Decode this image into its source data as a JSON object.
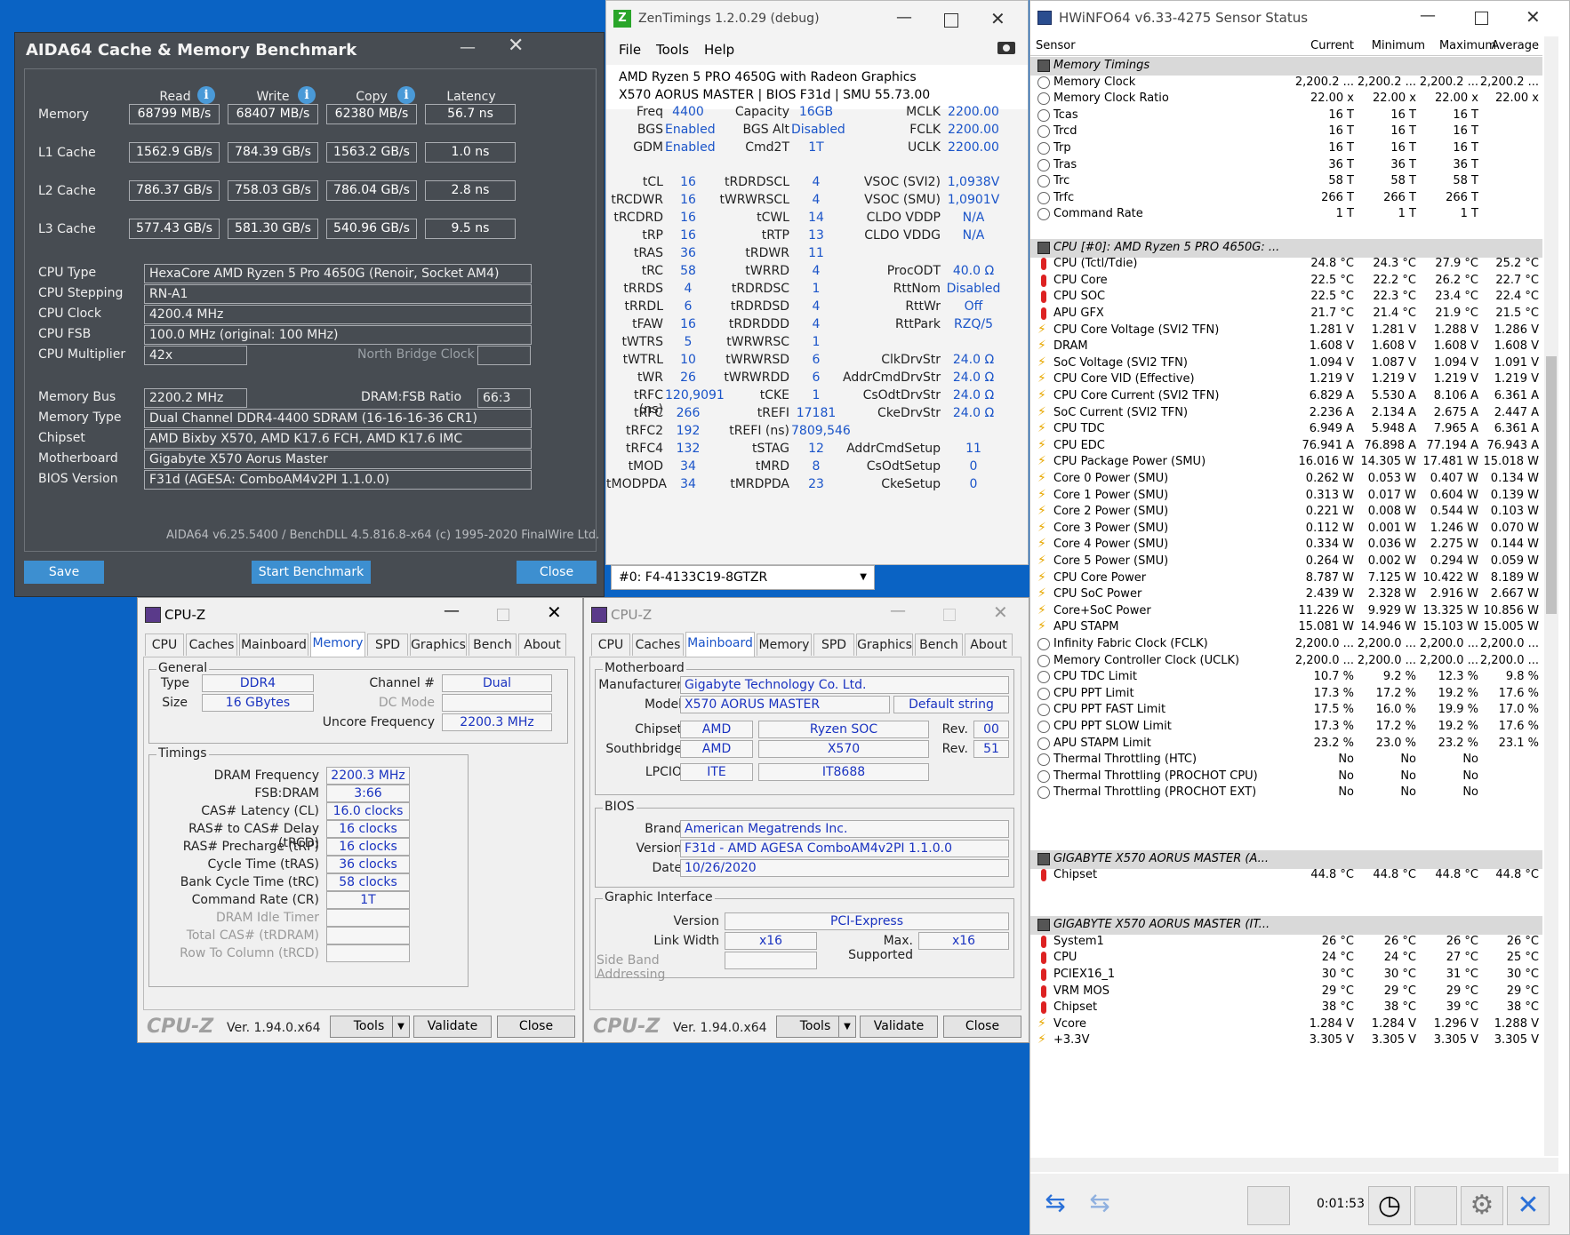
{
  "aida": {
    "title": "AIDA64 Cache & Memory Benchmark",
    "headers": {
      "read": "Read",
      "write": "Write",
      "copy": "Copy",
      "latency": "Latency"
    },
    "rows": [
      {
        "label": "Memory",
        "read": "68799 MB/s",
        "write": "68407 MB/s",
        "copy": "62380 MB/s",
        "latency": "56.7 ns"
      },
      {
        "label": "L1 Cache",
        "read": "1562.9 GB/s",
        "write": "784.39 GB/s",
        "copy": "1563.2 GB/s",
        "latency": "1.0 ns"
      },
      {
        "label": "L2 Cache",
        "read": "786.37 GB/s",
        "write": "758.03 GB/s",
        "copy": "786.04 GB/s",
        "latency": "2.8 ns"
      },
      {
        "label": "L3 Cache",
        "read": "577.43 GB/s",
        "write": "581.30 GB/s",
        "copy": "540.96 GB/s",
        "latency": "9.5 ns"
      }
    ],
    "cpu_type_label": "CPU Type",
    "cpu_type": "HexaCore AMD Ryzen 5 Pro 4650G  (Renoir, Socket AM4)",
    "cpu_stepping_label": "CPU Stepping",
    "cpu_stepping": "RN-A1",
    "cpu_clock_label": "CPU Clock",
    "cpu_clock": "4200.4 MHz",
    "cpu_fsb_label": "CPU FSB",
    "cpu_fsb": "100.0 MHz  (original: 100 MHz)",
    "cpu_mult_label": "CPU Multiplier",
    "cpu_mult": "42x",
    "nb_clock_label": "North Bridge Clock",
    "mem_bus_label": "Memory Bus",
    "mem_bus": "2200.2 MHz",
    "dram_fsb_label": "DRAM:FSB Ratio",
    "dram_fsb": "66:3",
    "mem_type_label": "Memory Type",
    "mem_type": "Dual Channel DDR4-4400 SDRAM  (16-16-16-36 CR1)",
    "chipset_label": "Chipset",
    "chipset": "AMD Bixby X570, AMD K17.6 FCH, AMD K17.6 IMC",
    "mobo_label": "Motherboard",
    "mobo": "Gigabyte X570 Aorus Master",
    "bios_label": "BIOS Version",
    "bios": "F31d  (AGESA: ComboAM4v2PI 1.1.0.0)",
    "footer": "AIDA64 v6.25.5400 / BenchDLL 4.5.816.8-x64  (c) 1995-2020 FinalWire Ltd.",
    "save": "Save",
    "start": "Start Benchmark",
    "close": "Close"
  },
  "zen": {
    "title": "ZenTimings 1.2.0.29 (debug)",
    "menu": [
      "File",
      "Tools",
      "Help"
    ],
    "cpu": "AMD Ryzen 5 PRO 4650G with Radeon Graphics",
    "board": "X570 AORUS MASTER | BIOS F31d | SMU 55.73.00",
    "top": [
      [
        "Freq",
        "4400",
        "Capacity",
        "16GB",
        "MCLK",
        "2200.00"
      ],
      [
        "BGS",
        "Enabled",
        "BGS Alt",
        "Disabled",
        "FCLK",
        "2200.00"
      ],
      [
        "GDM",
        "Enabled",
        "Cmd2T",
        "1T",
        "UCLK",
        "2200.00"
      ]
    ],
    "rows": [
      [
        "tCL",
        "16",
        "tRDRDSCL",
        "4",
        "VSOC (SVI2)",
        "1,0938V"
      ],
      [
        "tRCDWR",
        "16",
        "tWRWRSCL",
        "4",
        "VSOC (SMU)",
        "1,0901V"
      ],
      [
        "tRCDRD",
        "16",
        "tCWL",
        "14",
        "CLDO VDDP",
        "N/A"
      ],
      [
        "tRP",
        "16",
        "tRTP",
        "13",
        "CLDO VDDG",
        "N/A"
      ],
      [
        "tRAS",
        "36",
        "tRDWR",
        "11",
        "",
        ""
      ],
      [
        "tRC",
        "58",
        "tWRRD",
        "4",
        "ProcODT",
        "40.0 Ω"
      ],
      [
        "tRRDS",
        "4",
        "tRDRDSC",
        "1",
        "RttNom",
        "Disabled"
      ],
      [
        "tRRDL",
        "6",
        "tRDRDSD",
        "4",
        "RttWr",
        "Off"
      ],
      [
        "tFAW",
        "16",
        "tRDRDDD",
        "4",
        "RttPark",
        "RZQ/5"
      ],
      [
        "tWTRS",
        "5",
        "tWRWRSC",
        "1",
        "",
        ""
      ],
      [
        "tWTRL",
        "10",
        "tWRWRSD",
        "6",
        "ClkDrvStr",
        "24.0 Ω"
      ],
      [
        "tWR",
        "26",
        "tWRWRDD",
        "6",
        "AddrCmdDrvStr",
        "24.0 Ω"
      ],
      [
        "tRFC (ns)",
        "120,9091",
        "tCKE",
        "1",
        "CsOdtDrvStr",
        "24.0 Ω"
      ],
      [
        "tRFC",
        "266",
        "tREFI",
        "17181",
        "CkeDrvStr",
        "24.0 Ω"
      ],
      [
        "tRFC2",
        "192",
        "tREFI (ns)",
        "7809,546",
        "",
        ""
      ],
      [
        "tRFC4",
        "132",
        "tSTAG",
        "12",
        "AddrCmdSetup",
        "11"
      ],
      [
        "tMOD",
        "34",
        "tMRD",
        "8",
        "CsOdtSetup",
        "0"
      ],
      [
        "tMODPDA",
        "34",
        "tMRDPDA",
        "23",
        "CkeSetup",
        "0"
      ]
    ],
    "dimm": "#0: F4-4133C19-8GTZR"
  },
  "hw": {
    "title": "HWiNFO64 v6.33-4275 Sensor Status",
    "cols": [
      "Sensor",
      "Current",
      "Minimum",
      "Maximum",
      "Average"
    ],
    "rows": [
      {
        "t": "sec",
        "n": "Memory Timings"
      },
      {
        "t": "clk",
        "n": "Memory Clock",
        "v": [
          "2,200.2 ...",
          "2,200.2 ...",
          "2,200.2 ...",
          "2,200.2 ..."
        ]
      },
      {
        "t": "clk",
        "n": "Memory Clock Ratio",
        "v": [
          "22.00 x",
          "22.00 x",
          "22.00 x",
          "22.00 x"
        ]
      },
      {
        "t": "clk",
        "n": "Tcas",
        "v": [
          "16 T",
          "16 T",
          "16 T",
          ""
        ]
      },
      {
        "t": "clk",
        "n": "Trcd",
        "v": [
          "16 T",
          "16 T",
          "16 T",
          ""
        ]
      },
      {
        "t": "clk",
        "n": "Trp",
        "v": [
          "16 T",
          "16 T",
          "16 T",
          ""
        ]
      },
      {
        "t": "clk",
        "n": "Tras",
        "v": [
          "36 T",
          "36 T",
          "36 T",
          ""
        ]
      },
      {
        "t": "clk",
        "n": "Trc",
        "v": [
          "58 T",
          "58 T",
          "58 T",
          ""
        ]
      },
      {
        "t": "clk",
        "n": "Trfc",
        "v": [
          "266 T",
          "266 T",
          "266 T",
          ""
        ]
      },
      {
        "t": "clk",
        "n": "Command Rate",
        "v": [
          "1 T",
          "1 T",
          "1 T",
          ""
        ]
      },
      {
        "t": "gap"
      },
      {
        "t": "sec",
        "n": "CPU [#0]: AMD Ryzen 5 PRO 4650G: ..."
      },
      {
        "t": "temp",
        "n": "CPU (Tctl/Tdie)",
        "v": [
          "24.8 °C",
          "24.3 °C",
          "27.9 °C",
          "25.2 °C"
        ]
      },
      {
        "t": "temp",
        "n": "CPU Core",
        "v": [
          "22.5 °C",
          "22.2 °C",
          "26.2 °C",
          "22.7 °C"
        ]
      },
      {
        "t": "temp",
        "n": "CPU SOC",
        "v": [
          "22.5 °C",
          "22.3 °C",
          "23.4 °C",
          "22.4 °C"
        ]
      },
      {
        "t": "temp",
        "n": "APU GFX",
        "v": [
          "21.7 °C",
          "21.4 °C",
          "21.9 °C",
          "21.5 °C"
        ]
      },
      {
        "t": "volt",
        "n": "CPU Core Voltage (SVI2 TFN)",
        "v": [
          "1.281 V",
          "1.281 V",
          "1.288 V",
          "1.286 V"
        ]
      },
      {
        "t": "volt",
        "n": "DRAM",
        "v": [
          "1.608 V",
          "1.608 V",
          "1.608 V",
          "1.608 V"
        ]
      },
      {
        "t": "volt",
        "n": "SoC Voltage (SVI2 TFN)",
        "v": [
          "1.094 V",
          "1.087 V",
          "1.094 V",
          "1.091 V"
        ]
      },
      {
        "t": "volt",
        "n": "CPU Core VID (Effective)",
        "v": [
          "1.219 V",
          "1.219 V",
          "1.219 V",
          "1.219 V"
        ]
      },
      {
        "t": "volt",
        "n": "CPU Core Current (SVI2 TFN)",
        "v": [
          "6.829 A",
          "5.530 A",
          "8.106 A",
          "6.361 A"
        ]
      },
      {
        "t": "volt",
        "n": "SoC Current (SVI2 TFN)",
        "v": [
          "2.236 A",
          "2.134 A",
          "2.675 A",
          "2.447 A"
        ]
      },
      {
        "t": "volt",
        "n": "CPU TDC",
        "v": [
          "6.949 A",
          "5.948 A",
          "7.965 A",
          "6.361 A"
        ]
      },
      {
        "t": "volt",
        "n": "CPU EDC",
        "v": [
          "76.941 A",
          "76.898 A",
          "77.194 A",
          "76.943 A"
        ]
      },
      {
        "t": "volt",
        "n": "CPU Package Power (SMU)",
        "v": [
          "16.016 W",
          "14.305 W",
          "17.481 W",
          "15.018 W"
        ]
      },
      {
        "t": "volt",
        "n": "Core 0 Power (SMU)",
        "v": [
          "0.262 W",
          "0.053 W",
          "0.407 W",
          "0.134 W"
        ]
      },
      {
        "t": "volt",
        "n": "Core 1 Power (SMU)",
        "v": [
          "0.313 W",
          "0.017 W",
          "0.604 W",
          "0.139 W"
        ]
      },
      {
        "t": "volt",
        "n": "Core 2 Power (SMU)",
        "v": [
          "0.221 W",
          "0.008 W",
          "0.544 W",
          "0.103 W"
        ]
      },
      {
        "t": "volt",
        "n": "Core 3 Power (SMU)",
        "v": [
          "0.112 W",
          "0.001 W",
          "1.246 W",
          "0.070 W"
        ]
      },
      {
        "t": "volt",
        "n": "Core 4 Power (SMU)",
        "v": [
          "0.334 W",
          "0.036 W",
          "2.275 W",
          "0.144 W"
        ]
      },
      {
        "t": "volt",
        "n": "Core 5 Power (SMU)",
        "v": [
          "0.264 W",
          "0.002 W",
          "0.294 W",
          "0.059 W"
        ]
      },
      {
        "t": "volt",
        "n": "CPU Core Power",
        "v": [
          "8.787 W",
          "7.125 W",
          "10.422 W",
          "8.189 W"
        ]
      },
      {
        "t": "volt",
        "n": "CPU SoC Power",
        "v": [
          "2.439 W",
          "2.328 W",
          "2.916 W",
          "2.667 W"
        ]
      },
      {
        "t": "volt",
        "n": "Core+SoC Power",
        "v": [
          "11.226 W",
          "9.929 W",
          "13.325 W",
          "10.856 W"
        ]
      },
      {
        "t": "volt",
        "n": "APU STAPM",
        "v": [
          "15.081 W",
          "14.946 W",
          "15.103 W",
          "15.005 W"
        ]
      },
      {
        "t": "clk",
        "n": "Infinity Fabric Clock (FCLK)",
        "v": [
          "2,200.0 ...",
          "2,200.0 ...",
          "2,200.0 ...",
          "2,200.0 ..."
        ]
      },
      {
        "t": "clk",
        "n": "Memory Controller Clock (UCLK)",
        "v": [
          "2,200.0 ...",
          "2,200.0 ...",
          "2,200.0 ...",
          "2,200.0 ..."
        ]
      },
      {
        "t": "clk",
        "n": "CPU TDC Limit",
        "v": [
          "10.7 %",
          "9.2 %",
          "12.3 %",
          "9.8 %"
        ]
      },
      {
        "t": "clk",
        "n": "CPU PPT Limit",
        "v": [
          "17.3 %",
          "17.2 %",
          "19.2 %",
          "17.6 %"
        ]
      },
      {
        "t": "clk",
        "n": "CPU PPT FAST Limit",
        "v": [
          "17.5 %",
          "16.0 %",
          "19.9 %",
          "17.0 %"
        ]
      },
      {
        "t": "clk",
        "n": "CPU PPT SLOW Limit",
        "v": [
          "17.3 %",
          "17.2 %",
          "19.2 %",
          "17.6 %"
        ]
      },
      {
        "t": "clk",
        "n": "APU STAPM Limit",
        "v": [
          "23.2 %",
          "23.0 %",
          "23.2 %",
          "23.1 %"
        ]
      },
      {
        "t": "clk",
        "n": "Thermal Throttling (HTC)",
        "v": [
          "No",
          "No",
          "No",
          ""
        ]
      },
      {
        "t": "clk",
        "n": "Thermal Throttling (PROCHOT CPU)",
        "v": [
          "No",
          "No",
          "No",
          ""
        ]
      },
      {
        "t": "clk",
        "n": "Thermal Throttling (PROCHOT EXT)",
        "v": [
          "No",
          "No",
          "No",
          ""
        ]
      },
      {
        "t": "gap"
      },
      {
        "t": "gap"
      },
      {
        "t": "gap"
      },
      {
        "t": "sec",
        "n": "GIGABYTE X570 AORUS MASTER (A..."
      },
      {
        "t": "temp",
        "n": "Chipset",
        "v": [
          "44.8 °C",
          "44.8 °C",
          "44.8 °C",
          "44.8 °C"
        ]
      },
      {
        "t": "gap"
      },
      {
        "t": "gap"
      },
      {
        "t": "sec",
        "n": "GIGABYTE X570 AORUS MASTER (IT..."
      },
      {
        "t": "temp",
        "n": "System1",
        "v": [
          "26 °C",
          "26 °C",
          "26 °C",
          "26 °C"
        ]
      },
      {
        "t": "temp",
        "n": "CPU",
        "v": [
          "24 °C",
          "24 °C",
          "27 °C",
          "25 °C"
        ]
      },
      {
        "t": "temp",
        "n": "PCIEX16_1",
        "v": [
          "30 °C",
          "30 °C",
          "31 °C",
          "30 °C"
        ]
      },
      {
        "t": "temp",
        "n": "VRM MOS",
        "v": [
          "29 °C",
          "29 °C",
          "29 °C",
          "29 °C"
        ]
      },
      {
        "t": "temp",
        "n": "Chipset",
        "v": [
          "38 °C",
          "38 °C",
          "39 °C",
          "38 °C"
        ]
      },
      {
        "t": "volt",
        "n": "Vcore",
        "v": [
          "1.284 V",
          "1.284 V",
          "1.296 V",
          "1.288 V"
        ]
      },
      {
        "t": "volt",
        "n": "+3.3V",
        "v": [
          "3.305 V",
          "3.305 V",
          "3.305 V",
          "3.305 V"
        ]
      }
    ],
    "timer": "0:01:53"
  },
  "cpuz_mem": {
    "title": "CPU-Z",
    "tabs": [
      "CPU",
      "Caches",
      "Mainboard",
      "Memory",
      "SPD",
      "Graphics",
      "Bench",
      "About"
    ],
    "general": "General",
    "type_l": "Type",
    "type": "DDR4",
    "size_l": "Size",
    "size": "16 GBytes",
    "ch_l": "Channel #",
    "ch": "Dual",
    "dc_l": "DC Mode",
    "unc_l": "Uncore Frequency",
    "unc": "2200.3 MHz",
    "timings": "Timings",
    "t": [
      [
        "DRAM Frequency",
        "2200.3 MHz"
      ],
      [
        "FSB:DRAM",
        "3:66"
      ],
      [
        "CAS# Latency (CL)",
        "16.0 clocks"
      ],
      [
        "RAS# to CAS# Delay (tRCD)",
        "16 clocks"
      ],
      [
        "RAS# Precharge (tRP)",
        "16 clocks"
      ],
      [
        "Cycle Time (tRAS)",
        "36 clocks"
      ],
      [
        "Bank Cycle Time (tRC)",
        "58 clocks"
      ],
      [
        "Command Rate (CR)",
        "1T"
      ],
      [
        "DRAM Idle Timer",
        ""
      ],
      [
        "Total CAS# (tRDRAM)",
        ""
      ],
      [
        "Row To Column (tRCD)",
        ""
      ]
    ],
    "logo": "CPU-Z",
    "ver": "Ver. 1.94.0.x64",
    "tools": "Tools",
    "validate": "Validate",
    "close": "Close"
  },
  "cpuz_mb": {
    "title": "CPU-Z",
    "tabs": [
      "CPU",
      "Caches",
      "Mainboard",
      "Memory",
      "SPD",
      "Graphics",
      "Bench",
      "About"
    ],
    "mb": "Motherboard",
    "manu_l": "Manufacturer",
    "manu": "Gigabyte Technology Co. Ltd.",
    "model_l": "Model",
    "model": "X570 AORUS MASTER",
    "model2": "Default string",
    "chip_l": "Chipset",
    "chip": "AMD",
    "chip2": "Ryzen SOC",
    "rev_l": "Rev.",
    "rev": "00",
    "sb_l": "Southbridge",
    "sb": "AMD",
    "sb2": "X570",
    "rev2": "51",
    "lpc_l": "LPCIO",
    "lpc": "ITE",
    "lpc2": "IT8688",
    "bios": "BIOS",
    "brand_l": "Brand",
    "brand": "American Megatrends Inc.",
    "ver_l": "Version",
    "bver": "F31d - AMD AGESA ComboAM4v2PI 1.1.0.0",
    "date_l": "Date",
    "date": "10/26/2020",
    "gi": "Graphic Interface",
    "gver_l": "Version",
    "gver": "PCI-Express",
    "lw_l": "Link Width",
    "lw": "x16",
    "ms_l": "Max. Supported",
    "ms": "x16",
    "sba_l": "Side Band Addressing",
    "logo": "CPU-Z",
    "ver": "Ver. 1.94.0.x64",
    "tools": "Tools",
    "validate": "Validate",
    "close": "Close"
  }
}
